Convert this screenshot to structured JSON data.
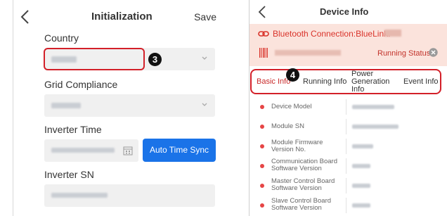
{
  "left_screen": {
    "title": "Initialization",
    "save_label": "Save",
    "country_label": "Country",
    "grid_label": "Grid Compliance",
    "time_label": "Inverter Time",
    "sync_label": "Auto Time Sync",
    "sn_label": "Inverter SN",
    "callout_number": "3"
  },
  "right_screen": {
    "title": "Device Info",
    "bluetooth_text": "Bluetooth Connection:BlueLink:",
    "running_status": "Running Status",
    "callout_number": "4",
    "tabs": [
      {
        "label": "Basic Info",
        "active": true
      },
      {
        "label": "Running Info",
        "active": false
      },
      {
        "label": "Power Generation Info",
        "active": false
      },
      {
        "label": "Event Info",
        "active": false
      }
    ],
    "rows": [
      {
        "label": "Device Model"
      },
      {
        "label": "Module SN"
      },
      {
        "label": "Module Firmware Version No."
      },
      {
        "label": "Communication Board Software Version"
      },
      {
        "label": "Master Control Board Software Version"
      },
      {
        "label": "Slave Control Board Software Version"
      }
    ]
  },
  "colors": {
    "accent_blue": "#1a73e8",
    "highlight_red": "#d32029",
    "banner_bg": "#fbe3dc",
    "status_dot": "#e64545"
  },
  "icons": [
    "chevron-left-icon",
    "chevron-down-icon",
    "calendar-icon",
    "link-icon",
    "barcode-icon",
    "close-circle-icon"
  ]
}
